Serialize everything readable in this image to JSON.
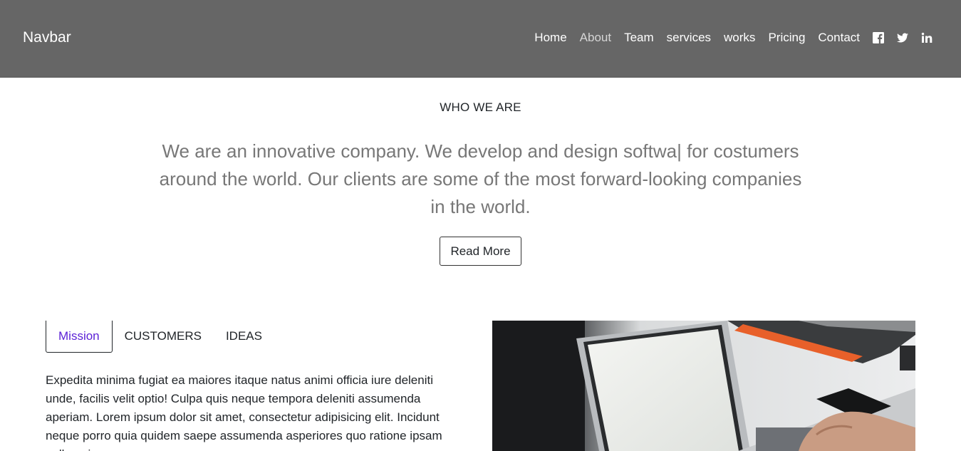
{
  "navbar": {
    "brand": "Navbar",
    "links": [
      {
        "label": "Home"
      },
      {
        "label": "About"
      },
      {
        "label": "Team"
      },
      {
        "label": "services"
      },
      {
        "label": "works"
      },
      {
        "label": "Pricing"
      },
      {
        "label": "Contact"
      }
    ],
    "active_link": "About",
    "social_icons": [
      "facebook-icon",
      "twitter-icon",
      "linkedin-icon"
    ]
  },
  "about": {
    "heading": "WHO WE ARE",
    "lead": "We are an innovative company. We develop and design softwa| for costumers around the world. Our clients are some of the most forward-looking companies in the world.",
    "button_label": "Read More"
  },
  "tabs": {
    "items": [
      {
        "label": "Mission"
      },
      {
        "label": "CUSTOMERS"
      },
      {
        "label": "IDEAS"
      }
    ],
    "active": "Mission",
    "content": "Expedita minima fugiat ea maiores itaque natus animi officia iure deleniti unde, facilis velit optio! Culpa quis neque tempora deleniti assumenda aperiam. Lorem ipsum dolor sit amet, consectetur adipisicing elit. Incidunt neque porro quia quidem saepe assumenda asperiores quo ratione ipsam nulla quia"
  },
  "colors": {
    "navbar_bg": "#666666",
    "active_tab": "#5a1fd6",
    "lead_text": "#777777"
  }
}
